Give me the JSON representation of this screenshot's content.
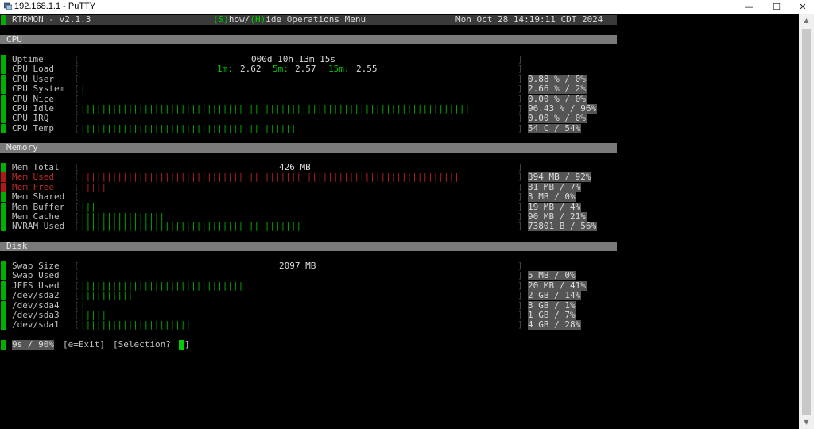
{
  "window": {
    "title": "192.168.1.1 - PuTTY",
    "minimize": "—",
    "maximize": "☐",
    "close": "✕"
  },
  "header": {
    "app": "RTRMON - v2.1.3",
    "menu_prefix": "(S)",
    "menu_mid": "how/",
    "menu_hide": "(H)",
    "menu_rest": "ide Operations Menu",
    "datetime": "Mon Oct 28 14:19:11 CDT 2024"
  },
  "colors": {
    "accent": "#00cc00",
    "section_bar": "#7a7a7a",
    "alert": "#c02828"
  },
  "sections": {
    "cpu": "CPU",
    "memory": "Memory",
    "disk": "Disk"
  },
  "cpu": {
    "uptime_label": "Uptime",
    "uptime_value": "000d 10h 13m 15s",
    "load_label": "CPU Load",
    "load_1m_label": "1m:",
    "load_1m": "2.62",
    "load_5m_label": "5m:",
    "load_5m": "2.57",
    "load_15m_label": "15m:",
    "load_15m": "2.55",
    "rows": [
      {
        "label": "CPU User",
        "value": "0.88 % / 0%",
        "bars": 0
      },
      {
        "label": "CPU System",
        "value": "2.66 % / 2%",
        "bars": 1
      },
      {
        "label": "CPU Nice",
        "value": "0.00 % / 0%",
        "bars": 0
      },
      {
        "label": "CPU Idle",
        "value": "96.43 % / 96%",
        "bars": 74
      },
      {
        "label": "CPU IRQ",
        "value": "0.00 % / 0%",
        "bars": 0
      },
      {
        "label": "CPU Temp",
        "value": "54 C / 54%",
        "bars": 41
      }
    ]
  },
  "memory": {
    "total_label": "Mem Total",
    "total_value": "426 MB",
    "rows": [
      {
        "label": "Mem Used",
        "value": "394 MB / 92%",
        "bars": 72
      },
      {
        "label": "Mem Free",
        "value": "31 MB / 7%",
        "bars": 5
      },
      {
        "label": "Mem Shared",
        "value": "3 MB / 0%",
        "bars": 0
      },
      {
        "label": "Mem Buffer",
        "value": "19 MB / 4%",
        "bars": 3
      },
      {
        "label": "Mem Cache",
        "value": "90 MB / 21%",
        "bars": 16
      },
      {
        "label": "NVRAM Used",
        "value": "73801 B / 56%",
        "bars": 43
      }
    ]
  },
  "disk": {
    "swap_label": "Swap Size",
    "swap_value": "2097 MB",
    "rows": [
      {
        "label": "Swap Used",
        "value": "5 MB / 0%",
        "bars": 0
      },
      {
        "label": "JFFS Used",
        "value": "20 MB / 41%",
        "bars": 31
      },
      {
        "label": "/dev/sda2",
        "value": "2 GB / 14%",
        "bars": 10
      },
      {
        "label": "/dev/sda4",
        "value": "3 GB / 1%",
        "bars": 1
      },
      {
        "label": "/dev/sda3",
        "value": "1 GB / 7%",
        "bars": 5
      },
      {
        "label": "/dev/sda1",
        "value": "4 GB / 28%",
        "bars": 21
      }
    ]
  },
  "footer": {
    "timer": "9s / 90%",
    "exit": "[e=Exit]",
    "prompt": "[Selection? ",
    "prompt_end": "]"
  }
}
